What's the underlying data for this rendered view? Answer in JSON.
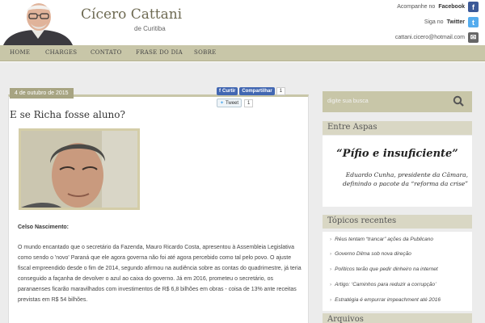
{
  "header": {
    "site_title": "Cícero Cattani",
    "site_subtitle": "de Curitiba",
    "social": {
      "facebook_prefix": "Acompanhe no",
      "facebook_name": "Facebook",
      "twitter_prefix": "Siga no",
      "twitter_name": "Twitter",
      "email": "cattani.cicero@hotmail.com"
    }
  },
  "nav": {
    "items": [
      "HOME",
      "CHARGES",
      "CONTATO",
      "FRASE DO DIA",
      "SOBRE"
    ]
  },
  "post": {
    "date": "4 de outubro de 2015",
    "facebook": {
      "curtir": "Curtir",
      "compartilhar": "Compartilhar",
      "count": "1"
    },
    "twitter": {
      "tweet": "Tweet",
      "count": "1"
    },
    "title": "E se Richa fosse aluno?",
    "author": "Celso Nascimento:",
    "paragraph": "O mundo encantado que o secretário da Fazenda, Mauro Ricardo Costa, apresentou à Assembleia Legislativa como sendo o 'novo' Paraná que ele agora governa não foi até agora percebido como tal pelo povo. O ajuste fiscal empreendido desde o fim de 2014, segundo afirmou na audiência sobre as contas do quadrimestre, já teria conseguido a façanha de devolver o azul ao caixa do governo. Já em 2016, prometeu o secretário, os paranaenses ficarão maravilhados com investimentos de R$ 6,8 bilhões em obras - coisa de 13% ante receitas previstas em R$ 54 bilhões."
  },
  "sidebar": {
    "search_placeholder": "digite sua busca",
    "entre_aspas_title": "Entre Aspas",
    "quote": "“Pífio e insuficiente”",
    "quote_attribution": "Eduardo Cunha, presidente da Câmara, definindo o pacote da “reforma da crise”",
    "recent_title": "Tópicos recentes",
    "recent_items": [
      "Réus tentam “trancar” ações da Publicano",
      "Governo Dilma sob nova direção",
      "Políticos terão que pedir dinheiro na internet",
      "Artigo: ‘Caminhos para reduzir a corrupção’",
      "Estratégia é empurrar impeachment até 2016"
    ],
    "archive_title": "Arquivos"
  }
}
